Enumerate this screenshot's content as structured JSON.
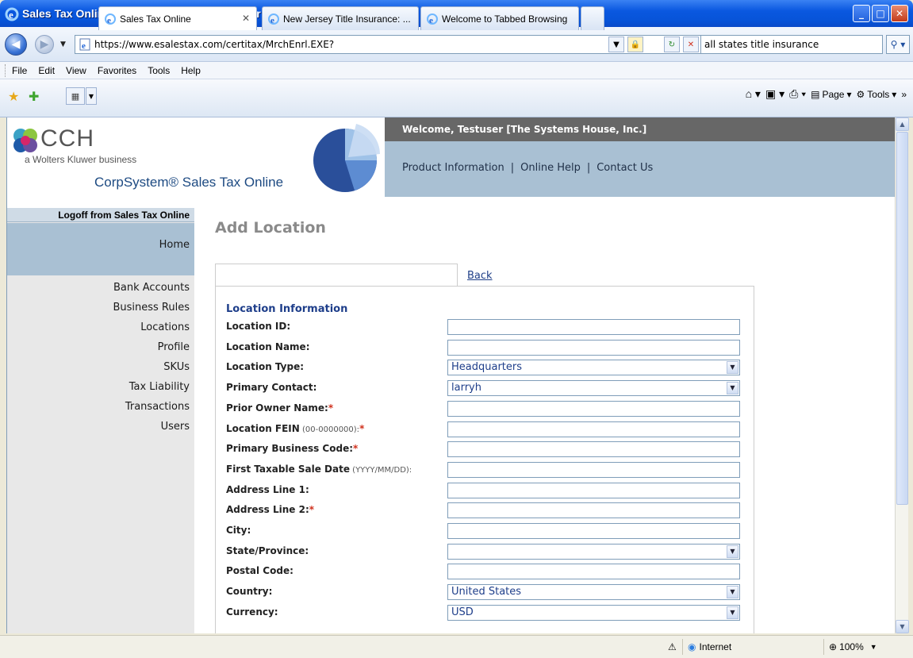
{
  "window": {
    "title": "Sales Tax Online - Windows Internet Explorer",
    "url": "https://www.esalestax.com/certitax/MrchEnrl.EXE?",
    "search_text": "all states title insurance"
  },
  "menu": [
    "File",
    "Edit",
    "View",
    "Favorites",
    "Tools",
    "Help"
  ],
  "tabs": [
    {
      "label": "Sales Tax Online"
    },
    {
      "label": "New Jersey Title Insurance: ..."
    },
    {
      "label": "Welcome to Tabbed Browsing"
    }
  ],
  "command_bar": {
    "page": "Page",
    "tools": "Tools"
  },
  "header": {
    "brand": "CCH",
    "tagline": "a Wolters Kluwer business",
    "product": "CorpSystem® Sales Tax Online",
    "welcome": "Welcome, Testuser [The Systems House, Inc.]",
    "links": [
      "Product Information",
      "Online Help",
      "Contact Us"
    ],
    "sep": "|"
  },
  "sidebar": {
    "logoff": "Logoff from Sales Tax Online",
    "home": "Home",
    "items": [
      "Bank Accounts",
      "Business Rules",
      "Locations",
      "Profile",
      "SKUs",
      "Tax Liability",
      "Transactions",
      "Users"
    ]
  },
  "main": {
    "title": "Add Location",
    "back": "Back",
    "section": "Location Information",
    "fields": [
      {
        "label": "Location ID:",
        "hint": "",
        "required": false,
        "type": "text",
        "value": ""
      },
      {
        "label": "Location Name:",
        "hint": "",
        "required": false,
        "type": "text",
        "value": ""
      },
      {
        "label": "Location Type:",
        "hint": "",
        "required": false,
        "type": "select",
        "value": "Headquarters"
      },
      {
        "label": "Primary Contact:",
        "hint": "",
        "required": false,
        "type": "select",
        "value": "larryh"
      },
      {
        "label": "Prior Owner Name:",
        "hint": "",
        "required": true,
        "type": "text",
        "value": ""
      },
      {
        "label": "Location FEIN",
        "hint": " (00-0000000):",
        "required": true,
        "type": "text",
        "value": ""
      },
      {
        "label": "Primary Business Code:",
        "hint": "",
        "required": true,
        "type": "text",
        "value": ""
      },
      {
        "label": "First Taxable Sale Date",
        "hint": " (YYYY/MM/DD):",
        "required": false,
        "type": "text",
        "value": ""
      },
      {
        "label": "Address Line 1:",
        "hint": "",
        "required": false,
        "type": "text",
        "value": ""
      },
      {
        "label": "Address Line 2:",
        "hint": "",
        "required": true,
        "type": "text",
        "value": ""
      },
      {
        "label": "City:",
        "hint": "",
        "required": false,
        "type": "text",
        "value": ""
      },
      {
        "label": "State/Province:",
        "hint": "",
        "required": false,
        "type": "select",
        "value": ""
      },
      {
        "label": "Postal Code:",
        "hint": "",
        "required": false,
        "type": "text",
        "value": ""
      },
      {
        "label": "Country:",
        "hint": "",
        "required": false,
        "type": "select",
        "value": "United States"
      },
      {
        "label": "Currency:",
        "hint": "",
        "required": false,
        "type": "select",
        "value": "USD"
      }
    ]
  },
  "status": {
    "zone": "Internet",
    "zoom": "100%"
  },
  "colors": {
    "titlebar": "#0a58e0",
    "welcome_bar": "#676767",
    "header_blue": "#a9c0d3",
    "section_title": "#1e3e8a",
    "required": "#d0311d"
  }
}
